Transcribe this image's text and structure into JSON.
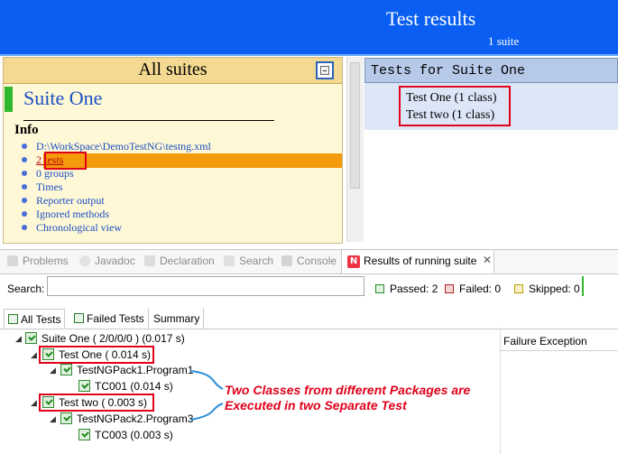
{
  "header": {
    "title": "Test results",
    "subtitle": "1 suite"
  },
  "left_panel": {
    "heading": "All suites",
    "suite_name": "Suite One",
    "info_title": "Info",
    "info_items": [
      "D:\\WorkSpace\\DemoTestNG\\testng.xml",
      "2 tests",
      "0 groups",
      "Times",
      "Reporter output",
      "Ignored methods",
      "Chronological view"
    ]
  },
  "right_panel": {
    "heading": "Tests for Suite One",
    "tests": [
      "Test One (1 class)",
      "Test two (1 class)"
    ]
  },
  "tabs": {
    "items": [
      "Problems",
      "Javadoc",
      "Declaration",
      "Search",
      "Console"
    ],
    "active": "Results of running suite",
    "close": "✕"
  },
  "search": {
    "label": "Search:",
    "value": ""
  },
  "stats": {
    "passed": "Passed: 2",
    "failed": "Failed: 0",
    "skipped": "Skipped: 0"
  },
  "subtabs": [
    "All Tests",
    "Failed Tests",
    "Summary"
  ],
  "tree": {
    "root": "Suite One ( 2/0/0/0 ) (0.017 s)",
    "test_one": "Test One ( 0.014 s)",
    "class_one": "TestNGPack1.Program1",
    "method_one": "TC001  (0.014 s)",
    "test_two": "Test two ( 0.003 s)",
    "class_two": "TestNGPack2.Program3",
    "method_two": "TC003  (0.003 s)"
  },
  "failure_header": "Failure Exception",
  "annotation": {
    "line1": "Two Classes from different Packages are",
    "line2": "Executed in two Separate Test"
  },
  "colors": {
    "header_blue": "#0a5ff2",
    "annotation_red": "#e0001a",
    "highlight_orange": "#f59a0a"
  }
}
